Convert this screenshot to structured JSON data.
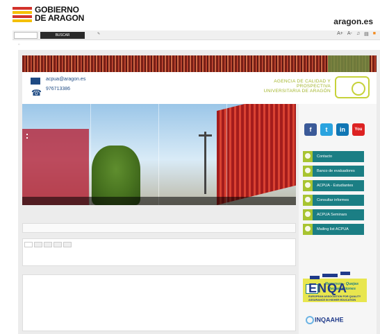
{
  "portal": {
    "gov_name": "GOBIERNO DE ARAGON",
    "site": "aragon.es",
    "search_placeholder": "",
    "search_button": "BUSCAR",
    "tools_link": "",
    "font_controls": [
      "A+",
      "A-"
    ]
  },
  "breadcrumb": "",
  "contact": {
    "email": "acpua@aragon.es",
    "phone": "976713386"
  },
  "agency": {
    "line1": "AGENCIA DE CALIDAD Y",
    "line2": "PROSPECTIVA",
    "line3": "UNIVERSITARIA DE ARAGÓN"
  },
  "hero": {
    "menu_items": [
      "",
      "",
      "",
      "",
      "",
      "",
      ""
    ],
    "captions": [
      "",
      "",
      "",
      ""
    ]
  },
  "sidebar": {
    "title": "",
    "social": [
      "f",
      "t",
      "in",
      "You"
    ],
    "menu": [
      "Contacto",
      "Banco de evaluadores",
      "ACPUA - Estudiantes",
      "Consultar informes",
      "ACPUA Seminars",
      "Mailing list ACPUA"
    ],
    "complaints_label": "Recursos - Quejas Reclamaciones"
  },
  "enqa": {
    "acronym": "ENQA",
    "full_name": "EUROPEAN ASSOCIATION FOR QUALITY ASSURANCE IN HIGHER EDUCATION"
  },
  "inqaahe": "INQAAHE",
  "section_bar": "",
  "tabs": {
    "labels": [
      "",
      "",
      "",
      "",
      ""
    ],
    "columns": [
      "",
      "",
      ""
    ]
  },
  "news": {
    "title": "",
    "items": [
      "",
      "",
      ""
    ],
    "more": ""
  },
  "colors": {
    "teal": "#1b7e84",
    "lime": "#a8c431",
    "yellow": "#e8e64f",
    "navy": "#1f3a8a",
    "hero_menu": "#b41e32"
  }
}
